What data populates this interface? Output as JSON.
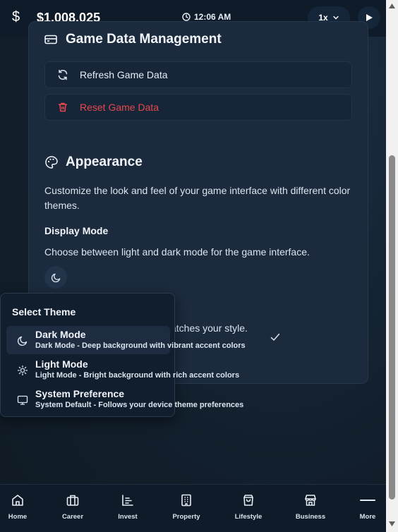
{
  "topbar": {
    "currency_symbol": "$",
    "balance": "$1,008,025",
    "time": "12:06 AM",
    "speed": "1x"
  },
  "data_card": {
    "title": "Game Data Management",
    "refresh_label": "Refresh Game Data",
    "reset_label": "Reset Game Data"
  },
  "appearance": {
    "title": "Appearance",
    "description": "Customize the look and feel of your game interface with different color themes.",
    "display_mode_heading": "Display Mode",
    "display_mode_description": "Choose between light and dark mode for the game interface.",
    "theme_partial_text": "atches your style."
  },
  "theme_menu": {
    "title": "Select Theme",
    "items": [
      {
        "name": "Dark Mode",
        "description": "Dark Mode - Deep background with vibrant accent colors",
        "icon": "moon-icon",
        "selected": true
      },
      {
        "name": "Light Mode",
        "description": "Light Mode - Bright background with rich accent colors",
        "icon": "sun-icon",
        "selected": false
      },
      {
        "name": "System Preference",
        "description": "System Default - Follows your device theme preferences",
        "icon": "monitor-icon",
        "selected": false
      }
    ]
  },
  "bottom_nav": {
    "items": [
      {
        "label": "Home",
        "icon": "home-icon"
      },
      {
        "label": "Career",
        "icon": "briefcase-icon"
      },
      {
        "label": "Invest",
        "icon": "chart-icon"
      },
      {
        "label": "Property",
        "icon": "building-icon"
      },
      {
        "label": "Lifestyle",
        "icon": "bag-icon"
      },
      {
        "label": "Business",
        "icon": "store-icon"
      },
      {
        "label": "More",
        "icon": "menu-icon"
      }
    ]
  },
  "colors": {
    "danger": "#e5484d",
    "accent_bg": "#1b2a3d"
  }
}
